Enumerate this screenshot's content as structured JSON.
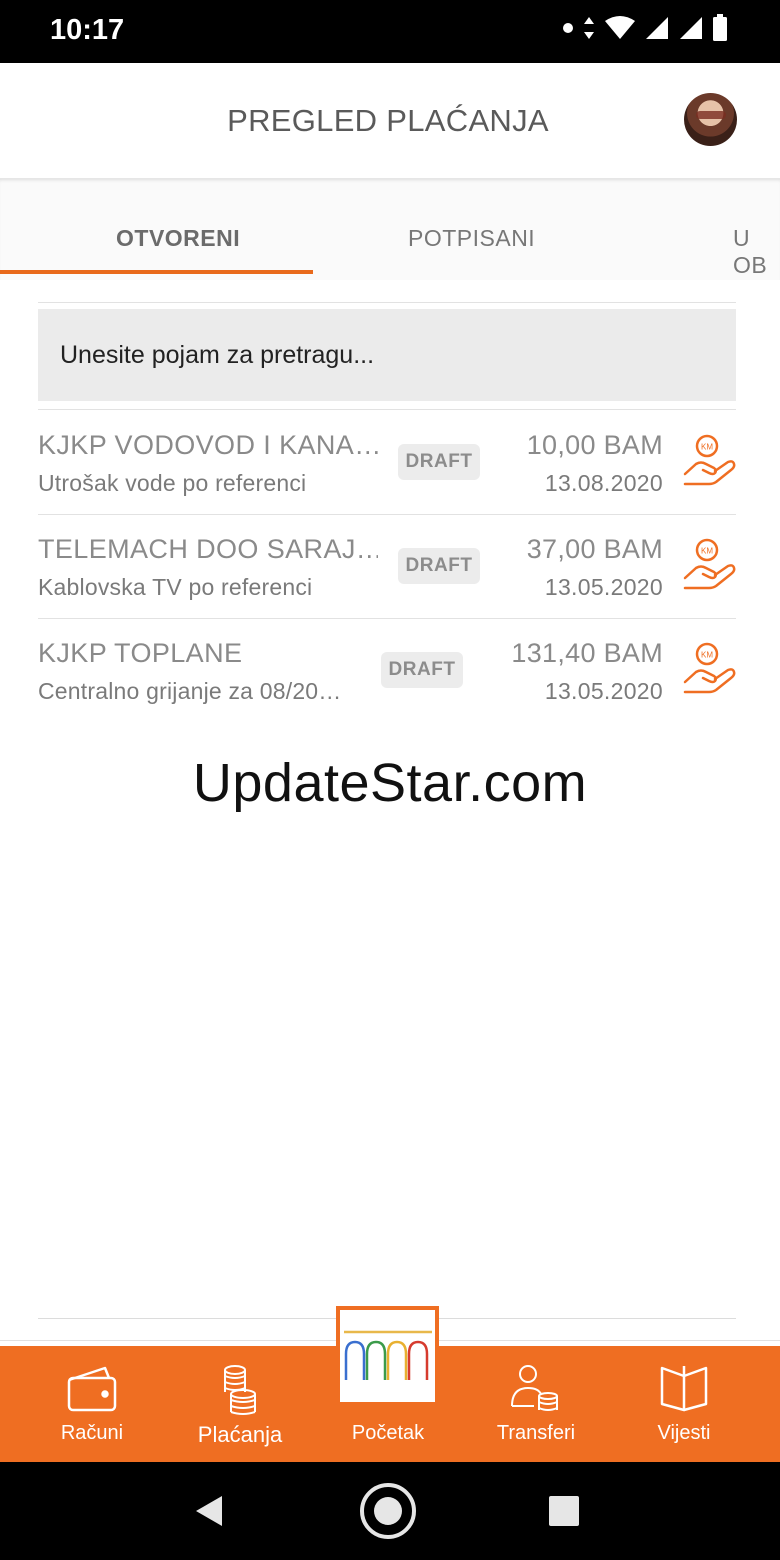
{
  "status_bar": {
    "time": "10:17",
    "icons": [
      "dot-icon",
      "data-arrows-icon",
      "wifi-icon",
      "signal-icon",
      "signal-icon",
      "battery-icon"
    ]
  },
  "header": {
    "title": "PREGLED PLAĆANJA",
    "avatar": "user-avatar"
  },
  "tabs": [
    {
      "label": "OTVORENI",
      "active": true
    },
    {
      "label": "POTPISANI",
      "active": false
    },
    {
      "label": "U OB",
      "active": false
    }
  ],
  "search": {
    "placeholder": "Unesite pojam za pretragu..."
  },
  "payments": [
    {
      "name": "KJKP VODOVOD I KANA…",
      "description": "Utrošak vode po referenci",
      "status": "DRAFT",
      "amount": "10,00 BAM",
      "date": "13.08.2020",
      "icon": "hand-coin-icon"
    },
    {
      "name": "TELEMACH DOO SARAJ…",
      "description": "Kablovska TV po referenci",
      "status": "DRAFT",
      "amount": "37,00 BAM",
      "date": "13.05.2020",
      "icon": "hand-coin-icon"
    },
    {
      "name": "KJKP TOPLANE",
      "description": "Centralno grijanje za 08/20…",
      "status": "DRAFT",
      "amount": "131,40 BAM",
      "date": "13.05.2020",
      "icon": "hand-coin-icon"
    }
  ],
  "watermark": "UpdateStar.com",
  "bottom_nav": [
    {
      "label": "Računi",
      "icon": "wallet-icon"
    },
    {
      "label": "Plaćanja",
      "icon": "coins-icon"
    },
    {
      "label": "Početak",
      "icon": "home-logo-icon"
    },
    {
      "label": "Transferi",
      "icon": "person-coins-icon"
    },
    {
      "label": "Vijesti",
      "icon": "book-icon"
    }
  ],
  "colors": {
    "accent": "#ef6e22",
    "tab_indicator": "#e8691b",
    "search_bg": "#ebebeb"
  }
}
